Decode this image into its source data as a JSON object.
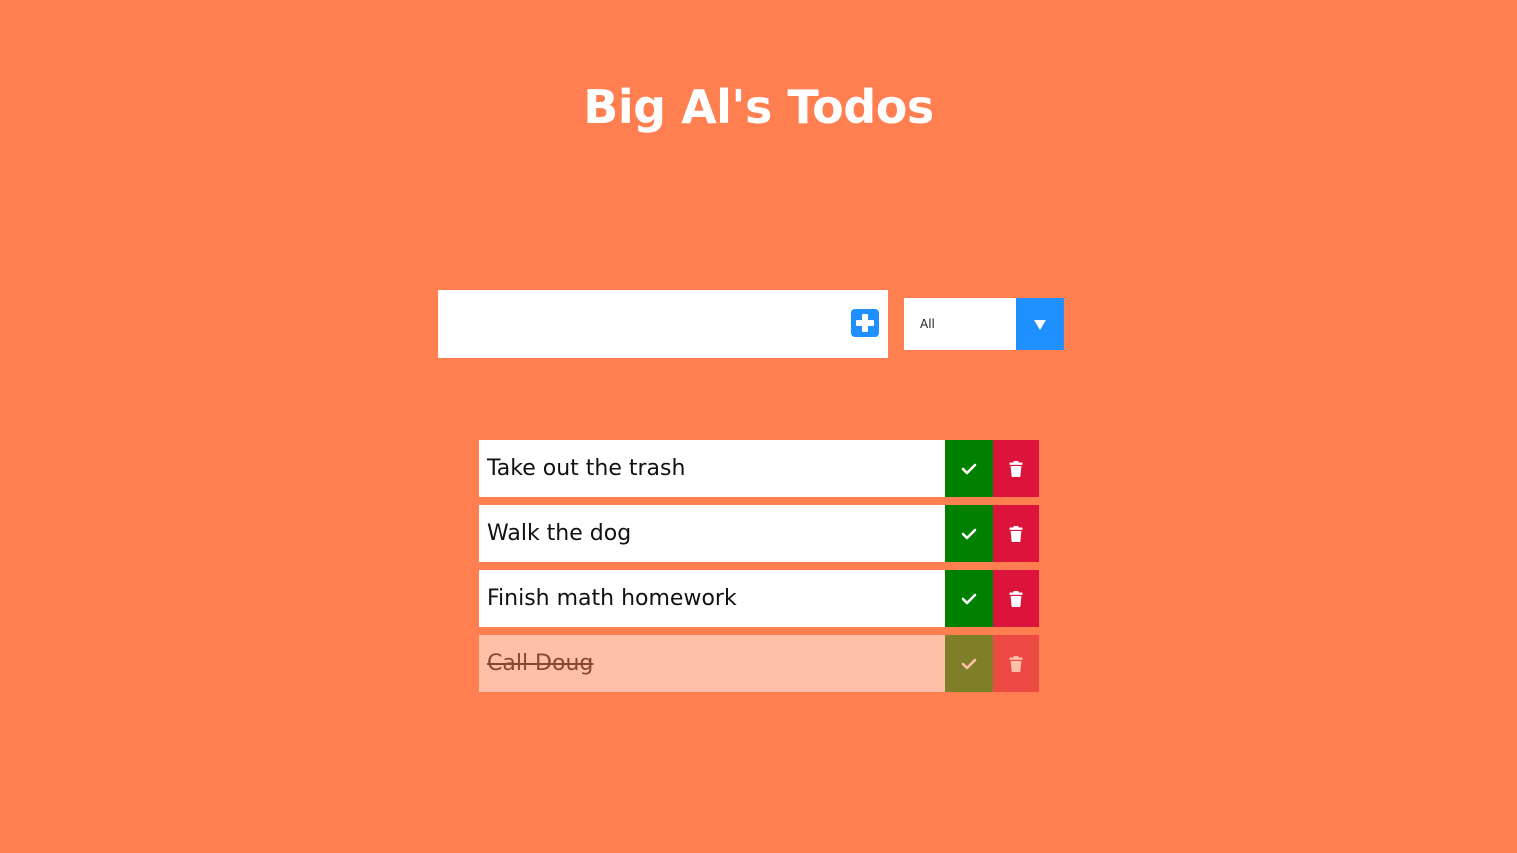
{
  "app": {
    "title": "Big Al's Todos"
  },
  "form": {
    "input_value": "",
    "input_placeholder": "",
    "add_icon": "plus-square-icon"
  },
  "filter": {
    "selected": "All",
    "options": [
      "All"
    ],
    "arrow_icon": "caret-down-icon"
  },
  "todos": [
    {
      "text": "Take out the trash",
      "completed": false
    },
    {
      "text": "Walk the dog",
      "completed": false
    },
    {
      "text": "Finish math homework",
      "completed": false
    },
    {
      "text": "Call Doug",
      "completed": true
    }
  ],
  "icons": {
    "complete": "check-icon",
    "delete": "trash-icon"
  },
  "colors": {
    "background": "#ff7f50",
    "accent": "#1e90ff",
    "complete": "#008000",
    "delete": "#dc143c"
  }
}
